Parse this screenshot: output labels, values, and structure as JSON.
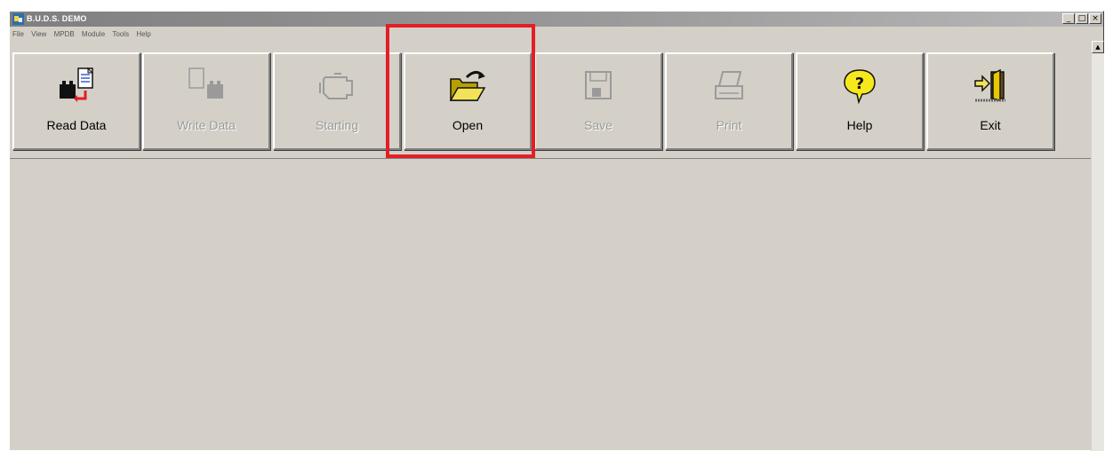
{
  "window": {
    "title": "B.U.D.S. DEMO",
    "controls": {
      "minimize": "_",
      "maximize": "□",
      "close": "×"
    }
  },
  "menu": [
    "File",
    "View",
    "MPDB",
    "Module",
    "Tools",
    "Help"
  ],
  "toolbar": {
    "buttons": [
      {
        "label": "Read Data",
        "icon": "read-data-icon",
        "enabled": true
      },
      {
        "label": "Write Data",
        "icon": "write-data-icon",
        "enabled": false
      },
      {
        "label": "Starting",
        "icon": "engine-icon",
        "enabled": false
      },
      {
        "label": "Open",
        "icon": "open-folder-icon",
        "enabled": true
      },
      {
        "label": "Save",
        "icon": "floppy-disk-icon",
        "enabled": false
      },
      {
        "label": "Print",
        "icon": "printer-icon",
        "enabled": false
      },
      {
        "label": "Help",
        "icon": "help-icon",
        "enabled": true
      },
      {
        "label": "Exit",
        "icon": "exit-door-icon",
        "enabled": true
      }
    ]
  },
  "scrollbar": {
    "up_arrow": "▲"
  },
  "colors": {
    "face": "#d4d0c8",
    "highlight_box": "#e31e24",
    "disabled_text": "#9a9a9a"
  }
}
